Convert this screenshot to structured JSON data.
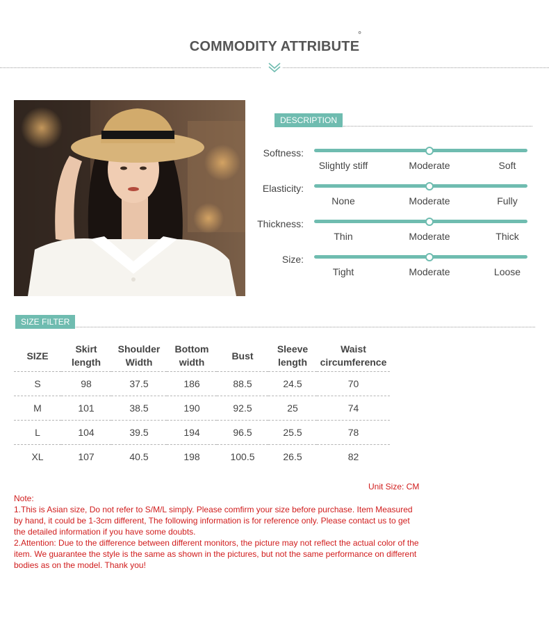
{
  "header": {
    "title": "COMMODITY ATTRIBUTE",
    "degree": "°"
  },
  "description": {
    "badge": "DESCRIPTION",
    "attributes": [
      {
        "label": "Softness:",
        "options": [
          "Slightly stiff",
          "Moderate",
          "Soft"
        ],
        "selected": 1
      },
      {
        "label": "Elasticity:",
        "options": [
          "None",
          "Moderate",
          "Fully"
        ],
        "selected": 1
      },
      {
        "label": "Thickness:",
        "options": [
          "Thin",
          "Moderate",
          "Thick"
        ],
        "selected": 1
      },
      {
        "label": "Size:",
        "options": [
          "Tight",
          "Moderate",
          "Loose"
        ],
        "selected": 1
      }
    ]
  },
  "size_filter": {
    "badge": "SIZE FILTER",
    "headers": [
      [
        "SIZE"
      ],
      [
        "Skirt",
        "length"
      ],
      [
        "Shoulder",
        "Width"
      ],
      [
        "Bottom",
        "width"
      ],
      [
        "Bust"
      ],
      [
        "Sleeve",
        "length"
      ],
      [
        "Waist",
        "circumference"
      ]
    ],
    "rows": [
      [
        "S",
        "98",
        "37.5",
        "186",
        "88.5",
        "24.5",
        "70"
      ],
      [
        "M",
        "101",
        "38.5",
        "190",
        "92.5",
        "25",
        "74"
      ],
      [
        "L",
        "104",
        "39.5",
        "194",
        "96.5",
        "25.5",
        "78"
      ],
      [
        "XL",
        "107",
        "40.5",
        "198",
        "100.5",
        "26.5",
        "82"
      ]
    ],
    "unit": "Unit Size: CM"
  },
  "notes": [
    "Note:",
    "1.This is Asian size, Do not refer to S/M/L simply. Please comfirm your size before purchase. Item Measured by hand, it could be 1-3cm different, The following information is for reference only. Please contact us to get the detailed information if you have some doubts.",
    "2.Attention: Due to the difference between different monitors, the picture may not reflect the actual color of the item. We guarantee the style is the same as shown in the pictures, but not the same performance on different bodies as on the model. Thank you!"
  ],
  "colors": {
    "accent": "#6fbcb0",
    "note_red": "#d01c1c",
    "text": "#444444"
  },
  "icons": {
    "header_chevron": "double-chevron-down-icon"
  }
}
